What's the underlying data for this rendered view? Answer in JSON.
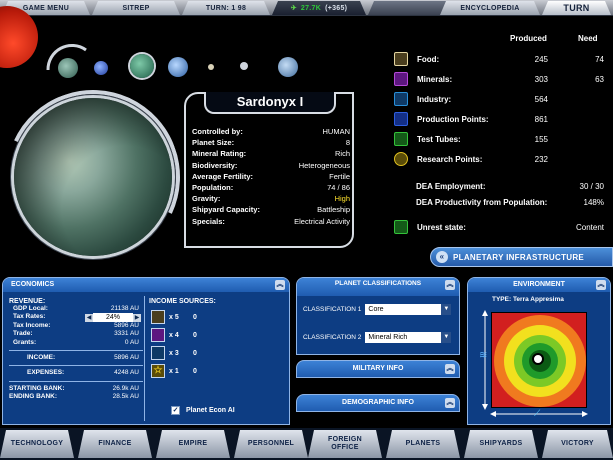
{
  "topbar": {
    "game_menu": "GAME MENU",
    "sitrep": "SITREP",
    "turn_counter": "TURN: 1 98",
    "credits": "27.7k",
    "credits_gain": "(+365)",
    "encyclopedia": "ENCYCLOPEDIA",
    "turn_button": "TURN"
  },
  "planet_info": {
    "name": "Sardonyx I",
    "rows": [
      {
        "k": "Controlled by:",
        "v": "HUMAN"
      },
      {
        "k": "Planet Size:",
        "v": "8"
      },
      {
        "k": "Mineral Rating:",
        "v": "Rich"
      },
      {
        "k": "Biodiversity:",
        "v": "Heterogeneous"
      },
      {
        "k": "Average Fertility:",
        "v": "Fertile"
      },
      {
        "k": "Population:",
        "v": "74 / 86"
      },
      {
        "k": "Gravity:",
        "v": "High"
      },
      {
        "k": "Shipyard Capacity:",
        "v": "Battleship"
      },
      {
        "k": "Specials:",
        "v": "Electrical Activity"
      }
    ]
  },
  "production": {
    "col_produced": "Produced",
    "col_need": "Need",
    "rows": [
      {
        "label": "Food:",
        "produced": "245",
        "need": "74",
        "icon": "food-icon",
        "color": "#e4d5a0"
      },
      {
        "label": "Minerals:",
        "produced": "303",
        "need": "63",
        "icon": "minerals-icon",
        "color": "#b54ad8"
      },
      {
        "label": "Industry:",
        "produced": "564",
        "need": "",
        "icon": "industry-icon",
        "color": "#2a8fd8"
      },
      {
        "label": "Production Points:",
        "produced": "861",
        "need": "",
        "icon": "production-icon",
        "color": "#2f5fe0"
      },
      {
        "label": "Test Tubes:",
        "produced": "155",
        "need": "",
        "icon": "test-tubes-icon",
        "color": "#34c23a"
      },
      {
        "label": "Research Points:",
        "produced": "232",
        "need": "",
        "icon": "research-icon",
        "color": "#e0c020"
      }
    ],
    "dea_employment_label": "DEA Employment:",
    "dea_employment_value": "30 / 30",
    "dea_productivity_label": "DEA Productivity from Population:",
    "dea_productivity_value": "148%",
    "unrest_label": "Unrest state:",
    "unrest_value": "Content",
    "planetary_infrastructure": "PLANETARY INFRASTRUCTURE"
  },
  "economics": {
    "title": "ECONOMICS",
    "revenue_head": "REVENUE:",
    "gdp_label": "GDP Local:",
    "gdp_value": "21138 AU",
    "tax_rates_label": "Tax Rates:",
    "tax_rates_value": "24%",
    "tax_income_label": "Tax Income:",
    "tax_income_value": "5896 AU",
    "trade_label": "Trade:",
    "trade_value": "3331 AU",
    "grants_label": "Grants:",
    "grants_value": "0 AU",
    "income_label": "INCOME:",
    "income_value": "5896 AU",
    "expenses_label": "EXPENSES:",
    "expenses_value": "4248 AU",
    "starting_bank_label": "STARTING BANK:",
    "starting_bank_value": "26.9k AU",
    "ending_bank_label": "ENDING BANK:",
    "ending_bank_value": "28.5k AU",
    "income_sources_head": "INCOME SOURCES:",
    "sources": [
      {
        "count": "x 5",
        "value": "0",
        "icon": "food-source-icon",
        "color": "#c9b77a"
      },
      {
        "count": "x 4",
        "value": "0",
        "icon": "minerals-source-icon",
        "color": "#a640d0"
      },
      {
        "count": "x 3",
        "value": "0",
        "icon": "research-source-icon",
        "color": "#2d9fd6"
      },
      {
        "count": "x 1",
        "value": "0",
        "icon": "star-source-icon",
        "color": "#e0c020"
      }
    ],
    "planet_econ_ai": "Planet Econ AI"
  },
  "classifications": {
    "title": "PLANET CLASSIFICATIONS",
    "c1_label": "CLASSIFICATION 1",
    "c1_value": "Core",
    "c2_label": "CLASSIFICATION 2",
    "c2_value": "Mineral Rich"
  },
  "military_info": "MILITARY INFO",
  "demographic_info": "DEMOGRAPHIC INFO",
  "environment": {
    "title": "ENVIRONMENT",
    "type": "TYPE: Terra Appresima"
  },
  "navbar": [
    "TECHNOLOGY",
    "FINANCE",
    "EMPIRE",
    "PERSONNEL",
    "FOREIGN OFFICE",
    "PLANETS",
    "SHIPYARDS",
    "VICTORY"
  ]
}
